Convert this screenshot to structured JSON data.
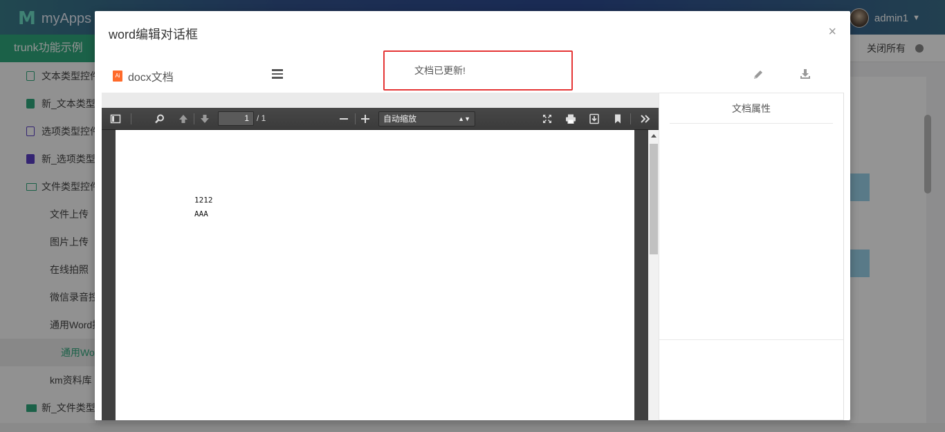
{
  "app": {
    "logo_text": "myApps",
    "user_name": "admin1"
  },
  "sidebar": {
    "title": "trunk功能示例",
    "items": [
      {
        "label": "文本类型控件"
      },
      {
        "label": "新_文本类型控件"
      },
      {
        "label": "选项类型控件"
      },
      {
        "label": "新_选项类型控件"
      },
      {
        "label": "文件类型控件"
      },
      {
        "label": "文件上传"
      },
      {
        "label": "图片上传"
      },
      {
        "label": "在线拍照"
      },
      {
        "label": "微信录音控件"
      },
      {
        "label": "通用Word控件"
      },
      {
        "label": "通用Word控件"
      },
      {
        "label": "km资料库"
      },
      {
        "label": "新_文件类型控件"
      }
    ]
  },
  "tabbar": {
    "close_all": "关闭所有"
  },
  "modal": {
    "title": "word编辑对话框",
    "close": "×",
    "doc_name": "docx文档",
    "file_icon_text": "Ai",
    "notice": "文档已更新!",
    "props_title": "文档属性"
  },
  "viewer": {
    "page_number": "1",
    "page_total": "/ 1",
    "zoom": "自动缩放",
    "page_lines": [
      "1212",
      "AAA"
    ]
  }
}
